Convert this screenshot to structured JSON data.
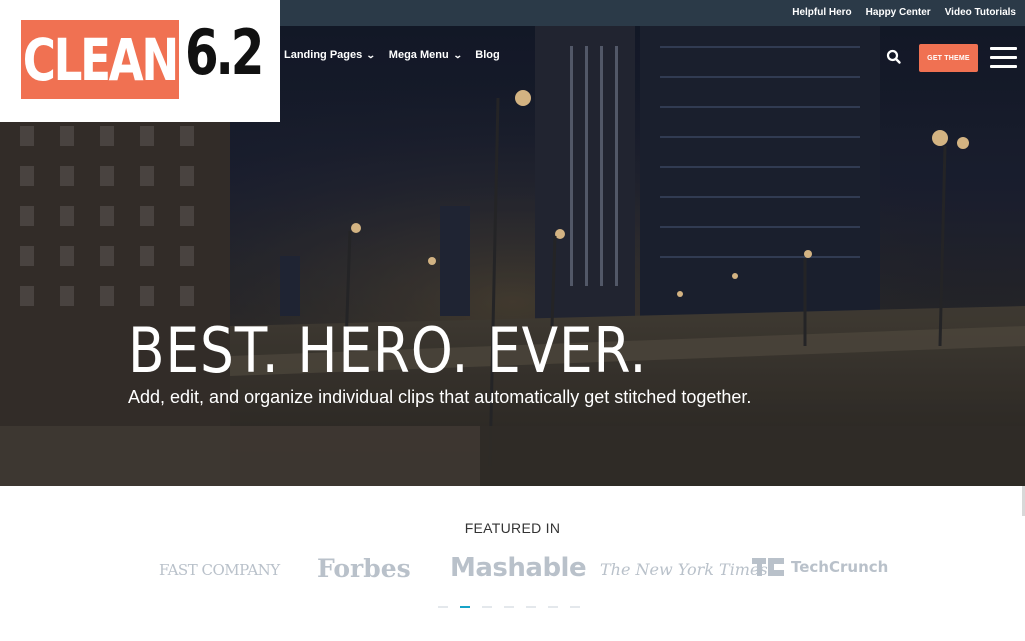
{
  "brand": {
    "logo_word": "CLEAN",
    "logo_version": "6.2",
    "accent": "#f07152"
  },
  "topbar": {
    "links": [
      "Helpful Hero",
      "Happy Center",
      "Video Tutorials"
    ]
  },
  "nav": {
    "items": [
      {
        "label": "Landing Pages",
        "has_dropdown": true
      },
      {
        "label": "Mega Menu",
        "has_dropdown": true
      },
      {
        "label": "Blog",
        "has_dropdown": false
      }
    ],
    "cta_label": "GET THEME",
    "search_icon": "search-icon",
    "menu_icon": "hamburger-icon"
  },
  "hero": {
    "title": "BEST. HERO. EVER.",
    "subtitle": "Add, edit, and organize individual clips that automatically get stitched together."
  },
  "featured": {
    "heading": "FEATURED IN",
    "logos": [
      "FAST COMPANY",
      "Forbes",
      "Mashable",
      "The New York Times",
      "TechCrunch"
    ],
    "carousel": {
      "count": 7,
      "active_index": 1,
      "active_color": "#17a3c7"
    }
  }
}
